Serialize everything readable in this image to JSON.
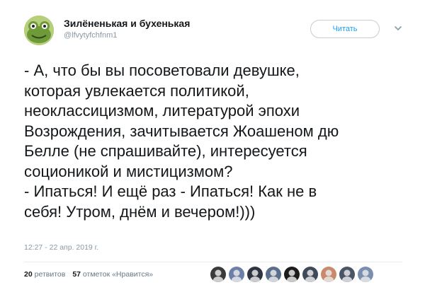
{
  "author": {
    "name": "Зилёненькая и бухенькая",
    "handle": "@lfvytyfchfnm1",
    "avatar_icon": "frog-avatar-icon"
  },
  "follow_button": {
    "label": "Читать"
  },
  "menu_icon": "chevron-down-icon",
  "tweet_lines": [
    "- А, что бы вы посоветовали девушке,",
    "которая увлекается политикой,",
    "неоклассицизмом, литературой эпохи",
    "Возрождения, зачитывается Жоашеном дю",
    "Белле (не спрашивайте), интересуется",
    "соционикой и мистицизмом?",
    "- Ипаться! И ещё раз - Ипаться! Как не в",
    "себя! Утром, днём и вечером!)))"
  ],
  "timestamp": "12:27 - 22 апр. 2019 г.",
  "stats": {
    "retweets_count": "20",
    "retweets_label": "ретвитов",
    "likes_count": "57",
    "likes_label": "отметок «Нравится»"
  },
  "likers": [
    {
      "icon": "user-avatar-1",
      "color": "#3a3a3a"
    },
    {
      "icon": "user-avatar-2",
      "color": "#6b7fa8"
    },
    {
      "icon": "user-avatar-3",
      "color": "#2e3440"
    },
    {
      "icon": "user-avatar-4",
      "color": "#5b6e8c"
    },
    {
      "icon": "user-avatar-5",
      "color": "#1c1c1c"
    },
    {
      "icon": "user-avatar-6",
      "color": "#3e4a5c"
    },
    {
      "icon": "user-avatar-7",
      "color": "#c98a6b"
    },
    {
      "icon": "user-avatar-8",
      "color": "#4a5568"
    },
    {
      "icon": "user-avatar-9",
      "color": "#7a8fb0"
    }
  ],
  "colors": {
    "accent": "#1da1f2",
    "muted": "#8899a6",
    "text": "#14171a"
  }
}
